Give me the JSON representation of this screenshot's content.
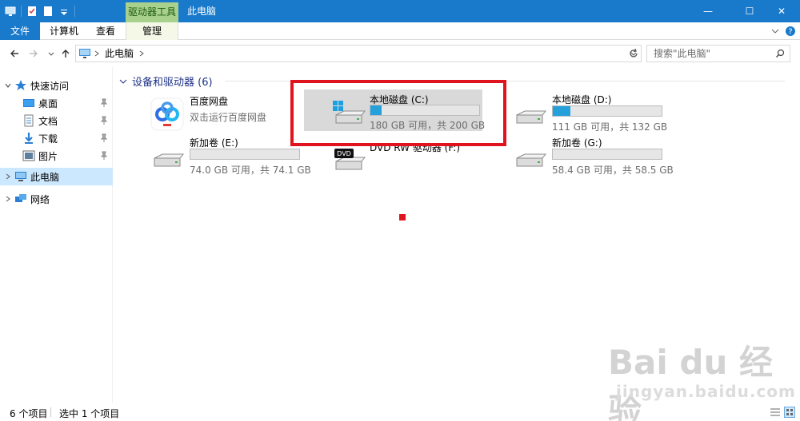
{
  "titlebar": {
    "drive_tools_label": "驱动器工具",
    "window_title": "此电脑",
    "minimize_glyph": "—",
    "maximize_glyph": "☐",
    "close_glyph": "✕"
  },
  "ribbon": {
    "tabs": [
      "文件",
      "计算机",
      "查看",
      "管理"
    ]
  },
  "address": {
    "path": "此电脑",
    "search_placeholder": "搜索\"此电脑\""
  },
  "sidebar": {
    "items": [
      {
        "label": "快速访问",
        "icon": "star-icon"
      },
      {
        "label": "桌面",
        "icon": "desktop-icon"
      },
      {
        "label": "文档",
        "icon": "document-icon"
      },
      {
        "label": "下载",
        "icon": "download-icon"
      },
      {
        "label": "图片",
        "icon": "pictures-icon"
      },
      {
        "label": "此电脑",
        "icon": "computer-icon"
      },
      {
        "label": "网络",
        "icon": "network-icon"
      }
    ]
  },
  "content": {
    "group_title": "设备和驱动器 (6)",
    "baidu_name": "百度网盘",
    "baidu_sub": "双击运行百度网盘",
    "drives": [
      {
        "name": "本地磁盘 (C:)",
        "sub": "180 GB 可用，共 200 GB",
        "used_fraction": 0.1
      },
      {
        "name": "本地磁盘 (D:)",
        "sub": "111 GB 可用，共 132 GB",
        "used_fraction": 0.16
      },
      {
        "name": "新加卷 (E:)",
        "sub": "74.0 GB 可用，共 74.1 GB",
        "used_fraction": 0.0
      },
      {
        "name": "DVD RW 驱动器 (F:)",
        "sub": "",
        "used_fraction": null
      },
      {
        "name": "新加卷 (G:)",
        "sub": "58.4 GB 可用，共 58.5 GB",
        "used_fraction": 0.0
      }
    ],
    "dvd_label": "DVD"
  },
  "status": {
    "count": "6 个项目",
    "selected": "选中 1 个项目"
  },
  "watermark": {
    "logo": "Bai du 经验",
    "sub": "jingyan.baidu.com"
  },
  "colors": {
    "titlebar": "#1979ca",
    "drive_tools": "#a9d18e",
    "highlight": "#e0141e",
    "bar_fill": "#26a0da"
  }
}
